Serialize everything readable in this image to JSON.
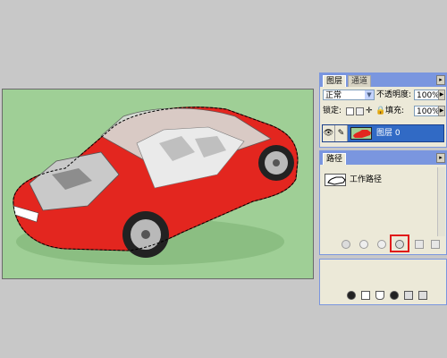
{
  "layers_panel": {
    "tabs": [
      {
        "label": "图层",
        "active": true
      },
      {
        "label": "通道",
        "active": false
      }
    ],
    "blend_mode": "正常",
    "opacity_label": "不透明度:",
    "opacity_value": "100%",
    "lock_label": "锁定:",
    "fill_label": "填充:",
    "fill_value": "100%",
    "layer": {
      "name": "图层 0",
      "visible": true
    }
  },
  "paths_panel": {
    "title": "路径",
    "paths": [
      {
        "name": "工作路径"
      }
    ]
  },
  "colors": {
    "canvas_bg": "#9fcf96",
    "car_red": "#e3261f",
    "selection_highlight": "#316ac5",
    "callout_red": "#e01a1a"
  }
}
